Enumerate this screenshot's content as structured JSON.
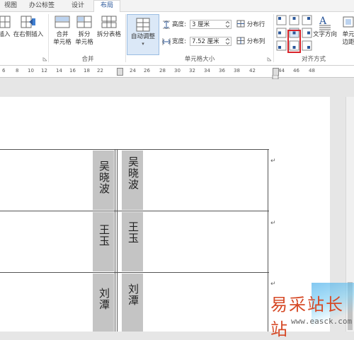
{
  "tabs": [
    "视图",
    "办公标签",
    "设计",
    "布局"
  ],
  "active_tab": "布局",
  "ribbon": {
    "insert_left_partial": "插入",
    "insert_right": "在右侧插入",
    "merge_group": {
      "label": "合并",
      "merge_cells": [
        "合并",
        "单元格"
      ],
      "split_cells": [
        "拆分",
        "单元格"
      ],
      "split_table": "拆分表格"
    },
    "cell_size_group": {
      "label": "单元格大小",
      "autofit": "自动调整",
      "height_label": "高度:",
      "height_value": "3 厘米",
      "width_label": "宽度:",
      "width_value": "7.52 厘米",
      "distribute_rows": "分布行",
      "distribute_cols": "分布列"
    },
    "alignment_group": {
      "label": "对齐方式",
      "text_direction": "文字方向",
      "cell_margins_partial": [
        "单元",
        "边距"
      ]
    }
  },
  "ruler": {
    "numbers": [
      "6",
      "8",
      "10",
      "12",
      "14",
      "16",
      "18",
      "22",
      "24",
      "26",
      "28",
      "30",
      "32",
      "34",
      "36",
      "38",
      "42",
      "44",
      "46",
      "48"
    ]
  },
  "table": {
    "rows": [
      {
        "col1": "吴晓波",
        "col2": "吴晓波"
      },
      {
        "col1": "王玉",
        "col2": "王玉"
      },
      {
        "col1": "刘潭",
        "col2": "刘潭"
      }
    ],
    "return_mark": "↵"
  },
  "watermark": {
    "text": "易采站长站",
    "url": "www.easck.com"
  }
}
